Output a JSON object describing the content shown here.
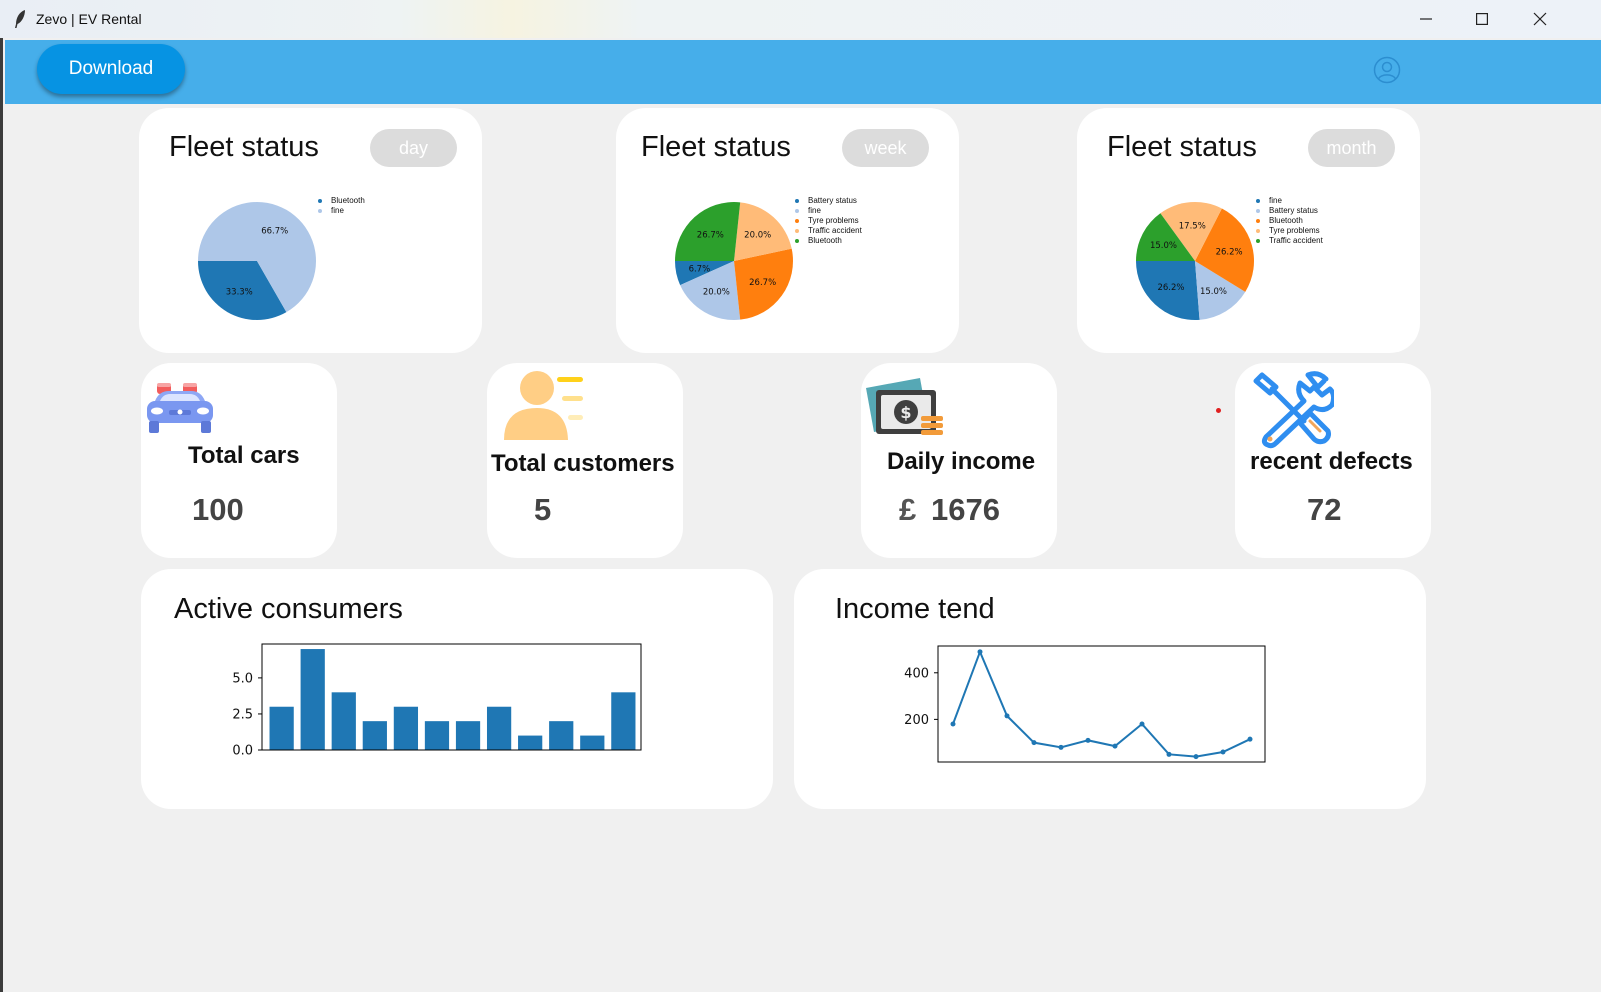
{
  "window": {
    "title": "Zevo | EV Rental"
  },
  "header": {
    "download_label": "Download"
  },
  "fleet_cards": [
    {
      "title": "Fleet status",
      "period": "day"
    },
    {
      "title": "Fleet status",
      "period": "week"
    },
    {
      "title": "Fleet status",
      "period": "month"
    }
  ],
  "stats": {
    "total_cars": {
      "label": "Total cars",
      "value": "100"
    },
    "total_customers": {
      "label": "Total customers",
      "value": "5"
    },
    "daily_income": {
      "label": "Daily income",
      "currency": "£",
      "value": "1676"
    },
    "recent_defects": {
      "label": "recent defects",
      "value": "72"
    }
  },
  "colors": {
    "header": "#46aeea",
    "download_button": "#0693e3",
    "badge": "#dcdcdc",
    "blue": "#1f77b4",
    "light_blue": "#aec7e8",
    "orange": "#ff7f0e",
    "light_orange": "#ffbb78",
    "green": "#2ca02c"
  },
  "chart_data": [
    {
      "type": "pie",
      "title": "Fleet status",
      "labels": [
        "Bluetooth",
        "fine"
      ],
      "values": [
        33.3,
        66.7
      ],
      "autopct": [
        "33.3%",
        "66.7%"
      ],
      "colors": [
        "#1f77b4",
        "#aec7e8"
      ]
    },
    {
      "type": "pie",
      "title": "Fleet status",
      "labels": [
        "Battery status",
        "fine",
        "Tyre problems",
        "Traffic accident",
        "Bluetooth"
      ],
      "values": [
        6.7,
        20.0,
        26.7,
        20.0,
        26.7
      ],
      "autopct": [
        "6.7%",
        "20.0%",
        "26.7%",
        "20.0%",
        "26.7%"
      ],
      "colors": [
        "#1f77b4",
        "#aec7e8",
        "#ff7f0e",
        "#ffbb78",
        "#2ca02c"
      ]
    },
    {
      "type": "pie",
      "title": "Fleet status",
      "labels": [
        "fine",
        "Battery status",
        "Bluetooth",
        "Tyre problems",
        "Traffic accident"
      ],
      "values": [
        26.2,
        15.0,
        26.2,
        17.5,
        15.0
      ],
      "autopct": [
        "26.2%",
        "15.0%",
        "26.2%",
        "17.5%",
        "15.0%"
      ],
      "colors": [
        "#1f77b4",
        "#aec7e8",
        "#ff7f0e",
        "#ffbb78",
        "#2ca02c"
      ]
    },
    {
      "type": "bar",
      "title": "Active consumers",
      "values": [
        3,
        7,
        4,
        2,
        3,
        2,
        2,
        3,
        1,
        2,
        1,
        4
      ],
      "ylim": [
        0,
        7.35
      ],
      "yticks": [
        "0.0",
        "2.5",
        "5.0"
      ],
      "color": "#1f77b4"
    },
    {
      "type": "line",
      "title": "Income tend",
      "values": [
        180,
        490,
        215,
        100,
        80,
        110,
        85,
        180,
        50,
        40,
        60,
        115
      ],
      "ylim": [
        17,
        515
      ],
      "yticks": [
        "200",
        "400"
      ],
      "color": "#1f77b4"
    }
  ]
}
